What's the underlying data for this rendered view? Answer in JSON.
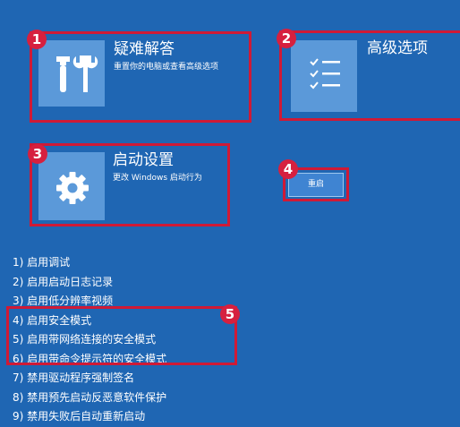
{
  "tiles": [
    {
      "badge": "1",
      "title": "疑难解答",
      "description": "重置你的电脑或查看高级选项",
      "icon": "tools-icon"
    },
    {
      "badge": "2",
      "title": "高级选项",
      "description": "",
      "icon": "checklist-icon"
    },
    {
      "badge": "3",
      "title": "启动设置",
      "description": "更改 Windows 启动行为",
      "icon": "gear-icon"
    }
  ],
  "restart": {
    "badge": "4",
    "label": "重启"
  },
  "options": {
    "badge": "5",
    "items": [
      "1) 启用调试",
      "2) 启用启动日志记录",
      "3) 启用低分辨率视频",
      "4) 启用安全模式",
      "5) 启用带网络连接的安全模式",
      "6) 启用带命令提示符的安全模式",
      "7) 禁用驱动程序强制签名",
      "8) 禁用预先启动反恶意软件保护",
      "9) 禁用失败后自动重新启动"
    ]
  },
  "colors": {
    "background": "#1f66b3",
    "tile": "#5b99d9",
    "highlight": "#cf1a36"
  }
}
